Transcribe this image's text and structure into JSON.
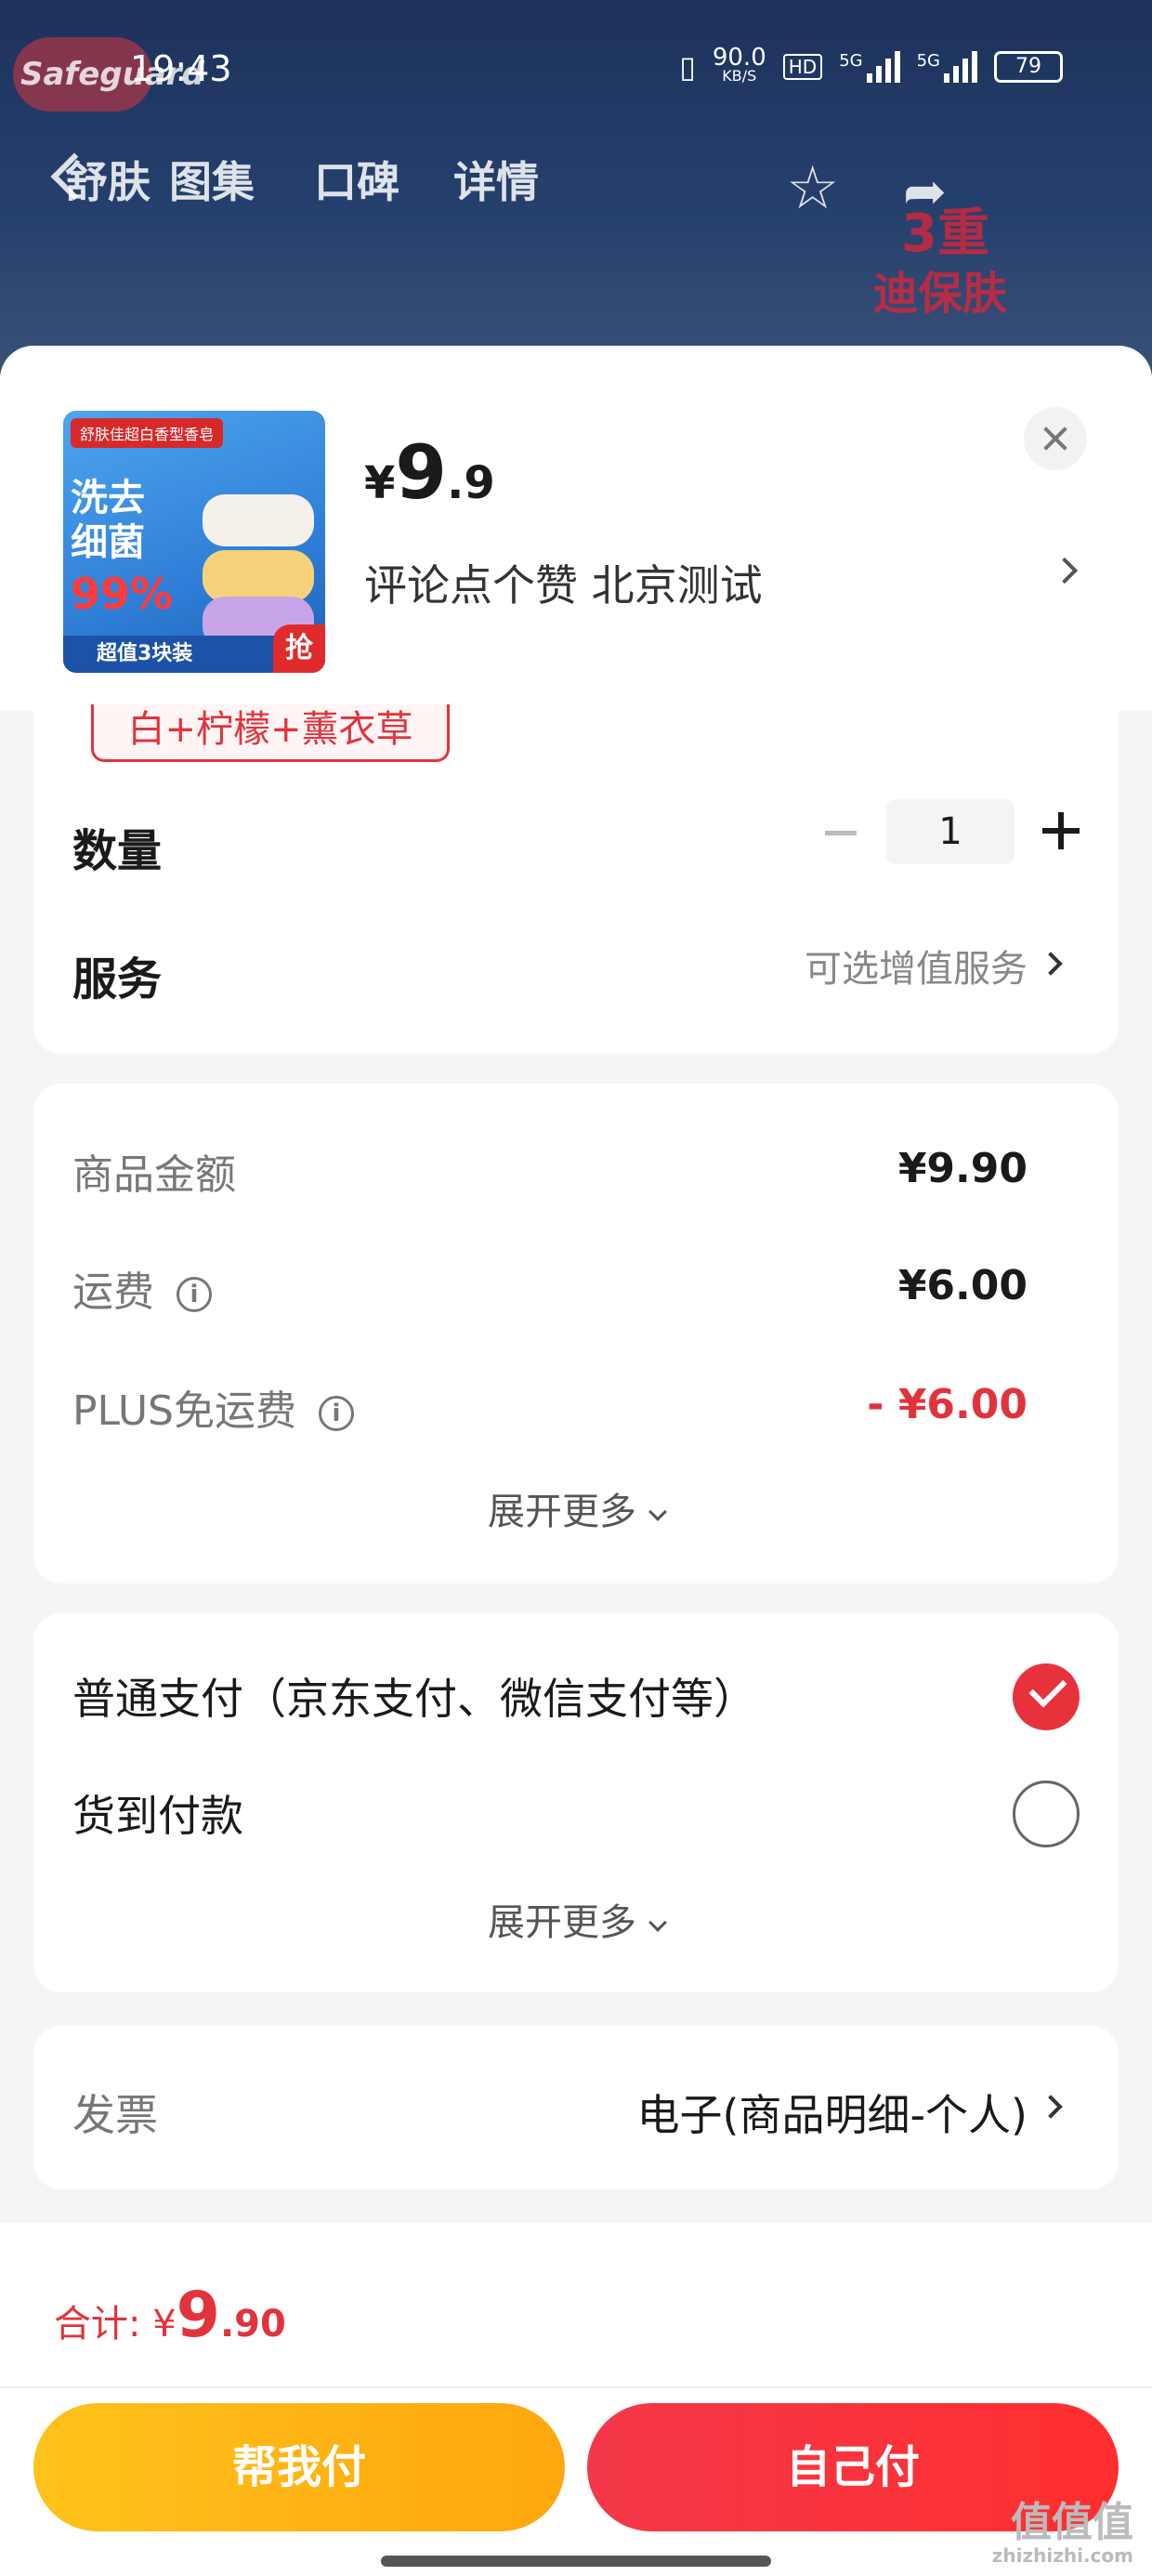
{
  "status_bar": {
    "time": "19:43",
    "net_speed_value": "90.0",
    "net_speed_unit": "KB/S",
    "hd": "HD",
    "signal1": "5G",
    "signal2": "5G",
    "battery": "79"
  },
  "top_nav": {
    "tabs": [
      "舒肤",
      "图集",
      "口碑",
      "详情"
    ],
    "brand": "Safeguard",
    "badge_line1": "3重",
    "badge_line2": "迪保肤"
  },
  "product": {
    "thumb_top": "舒肤佳超白香型香皂",
    "thumb_big": "洗去\n细菌",
    "thumb_99": "99%",
    "thumb_bottom": "超值3块装",
    "thumb_grab": "抢",
    "price_currency": "¥",
    "price_int": "9",
    "price_dec": ".9",
    "address": "评论点个赞  北京测试"
  },
  "spec": {
    "selected": "白+柠檬+薰衣草"
  },
  "quantity": {
    "label": "数量",
    "value": "1"
  },
  "service": {
    "label": "服务",
    "value": "可选增值服务"
  },
  "fees": {
    "goods_label": "商品金额",
    "goods_value": "¥9.90",
    "shipping_label": "运费",
    "shipping_value": "¥6.00",
    "plus_label": "PLUS免运费",
    "plus_value": "- ¥6.00",
    "expand": "展开更多"
  },
  "payment": {
    "option1": "普通支付（京东支付、微信支付等）",
    "option2": "货到付款",
    "expand": "展开更多"
  },
  "invoice": {
    "label": "发票",
    "value": "电子(商品明细-个人)"
  },
  "footer": {
    "total_label": "合计: ",
    "total_currency": "¥",
    "total_int": "9",
    "total_dec": ".90",
    "help_pay": "帮我付",
    "self_pay": "自己付"
  },
  "watermark": {
    "main": "值值值",
    "sub": "zhizhizhi.com"
  },
  "colors": {
    "accent_red": "#e2333c",
    "help_yellow": "#ffb214",
    "self_red": "#f4384a"
  }
}
